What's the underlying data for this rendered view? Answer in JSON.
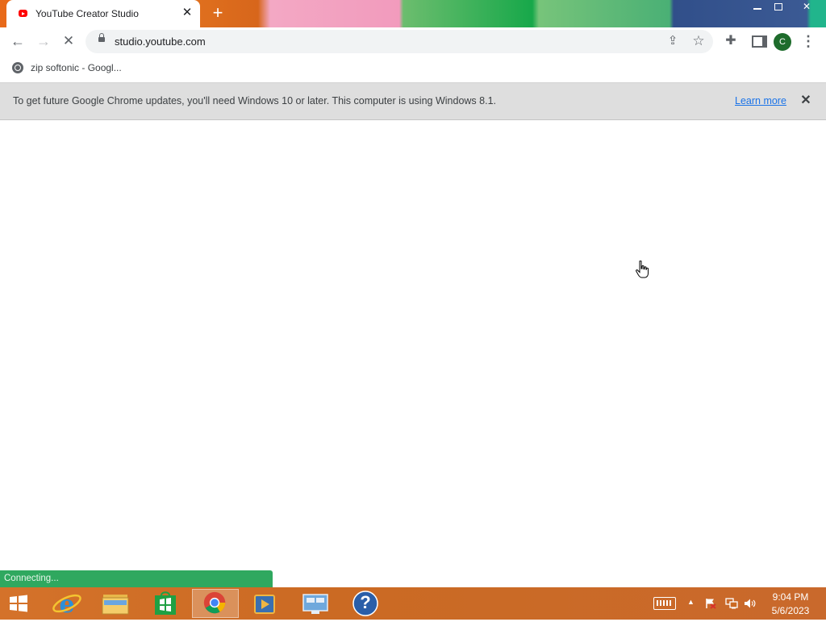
{
  "tab": {
    "title": "YouTube Creator Studio",
    "close": "✕",
    "new_tab": "+"
  },
  "window": {
    "close": "✕"
  },
  "toolbar": {
    "back": "←",
    "forward": "→",
    "stop": "✕",
    "url": "studio.youtube.com",
    "share": "⇪",
    "star": "☆",
    "extensions": "✚",
    "avatar_initial": "C",
    "menu": "⋮"
  },
  "bookmarks": [
    {
      "label": "zip softonic - Googl..."
    }
  ],
  "infobar": {
    "message": "To get future Google Chrome updates, you'll need Windows 10 or later. This computer is using Windows 8.1.",
    "link": "Learn more",
    "close": "✕"
  },
  "status": {
    "text": "Connecting..."
  },
  "taskbar": {
    "icons": [
      "windows-start",
      "internet-explorer",
      "file-explorer",
      "windows-store",
      "google-chrome",
      "media-player",
      "remote-desktop",
      "help"
    ],
    "active": "google-chrome",
    "help_glyph": "?"
  },
  "tray": {
    "arrow": "▲",
    "time": "9:04 PM",
    "date": "5/6/2023"
  },
  "colors": {
    "status_green": "#2fa85f",
    "taskbar_orange": "#d4722a",
    "infobar_bg": "#dedede",
    "link_blue": "#1a73e8"
  }
}
